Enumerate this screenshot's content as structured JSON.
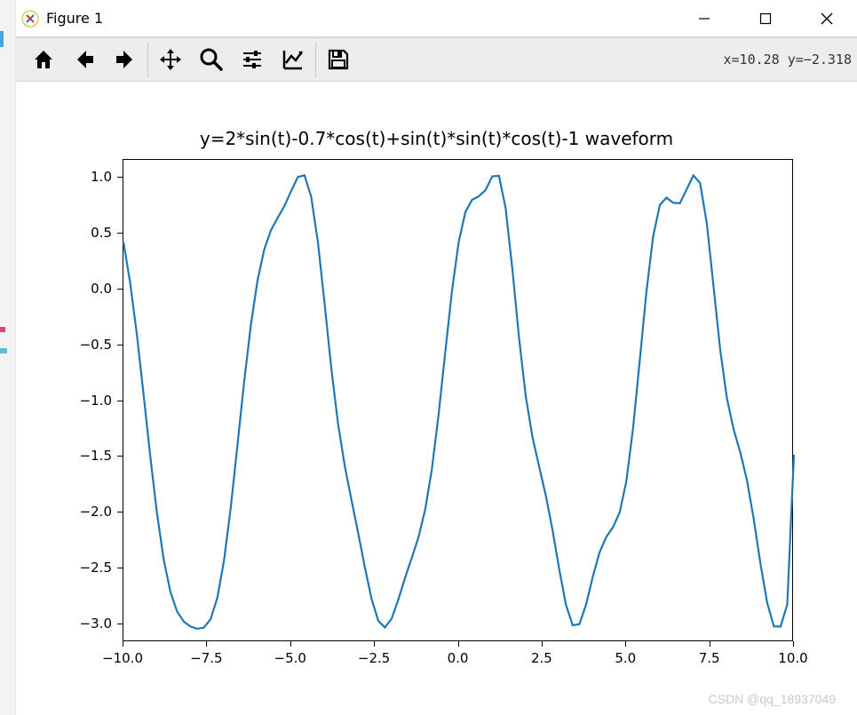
{
  "window": {
    "title": "Figure 1",
    "controls": {
      "min": "minimize",
      "max": "maximize",
      "close": "close"
    }
  },
  "toolbar": {
    "items": [
      "home",
      "back",
      "forward",
      "sep",
      "pan",
      "zoom",
      "configure",
      "edit-axes",
      "sep",
      "save"
    ],
    "readout": "x=10.28 y=−2.318"
  },
  "watermark": "CSDN @qq_18937049",
  "chart_data": {
    "type": "line",
    "title": "y=2*sin(t)-0.7*cos(t)+sin(t)*sin(t)*cos(t)-1 waveform",
    "xlabel": "",
    "ylabel": "",
    "xlim": [
      -10,
      10
    ],
    "ylim": [
      -3.16,
      1.16
    ],
    "xticks": [
      -10.0,
      -7.5,
      -5.0,
      -2.5,
      0.0,
      2.5,
      5.0,
      7.5,
      10.0
    ],
    "yticks": [
      -3.0,
      -2.5,
      -2.0,
      -1.5,
      -1.0,
      -0.5,
      0.0,
      0.5,
      1.0
    ],
    "line_color": "#1f77b4",
    "x": [
      -10.0,
      -9.8,
      -9.6,
      -9.4,
      -9.2,
      -9.0,
      -8.8,
      -8.6,
      -8.4,
      -8.2,
      -8.0,
      -7.8,
      -7.6,
      -7.4,
      -7.2,
      -7.0,
      -6.8,
      -6.6,
      -6.4,
      -6.2,
      -6.0,
      -5.8,
      -5.6,
      -5.4,
      -5.2,
      -5.0,
      -4.8,
      -4.6,
      -4.4,
      -4.2,
      -4.0,
      -3.8,
      -3.6,
      -3.4,
      -3.2,
      -3.0,
      -2.8,
      -2.6,
      -2.4,
      -2.2,
      -2.0,
      -1.8,
      -1.6,
      -1.4,
      -1.2,
      -1.0,
      -0.8,
      -0.6,
      -0.4,
      -0.2,
      0.0,
      0.2,
      0.4,
      0.6,
      0.8,
      1.0,
      1.2,
      1.4,
      1.6,
      1.8,
      2.0,
      2.2,
      2.4,
      2.6,
      2.8,
      3.0,
      3.2,
      3.4,
      3.6,
      3.8,
      4.0,
      4.2,
      4.4,
      4.6,
      4.8,
      5.0,
      5.2,
      5.4,
      5.6,
      5.8,
      6.0,
      6.2,
      6.4,
      6.6,
      6.8,
      7.0,
      7.2,
      7.4,
      7.6,
      7.8,
      8.0,
      8.2,
      8.4,
      8.6,
      8.8,
      9.0,
      9.2,
      9.4,
      9.6,
      9.8,
      10.0
    ],
    "y": [
      0.425,
      0.061,
      -0.403,
      -0.939,
      -1.494,
      -2.004,
      -2.418,
      -2.709,
      -2.885,
      -2.976,
      -3.02,
      -3.04,
      -3.03,
      -2.954,
      -2.763,
      -2.428,
      -1.957,
      -1.399,
      -0.829,
      -0.321,
      0.08,
      0.358,
      0.53,
      0.641,
      0.746,
      0.879,
      1.006,
      1.022,
      0.83,
      0.425,
      -0.127,
      -0.706,
      -1.2,
      -1.578,
      -1.884,
      -2.18,
      -2.487,
      -2.771,
      -2.968,
      -3.028,
      -2.949,
      -2.778,
      -2.584,
      -2.405,
      -2.221,
      -1.974,
      -1.611,
      -1.122,
      -0.56,
      -0.013,
      0.425,
      0.693,
      0.802,
      0.834,
      0.889,
      1.012,
      1.018,
      0.728,
      0.185,
      -0.434,
      -0.956,
      -1.322,
      -1.588,
      -1.848,
      -2.158,
      -2.508,
      -2.827,
      -3.009,
      -2.999,
      -2.823,
      -2.574,
      -2.357,
      -2.219,
      -2.131,
      -2.0,
      -1.72,
      -1.247,
      -0.639,
      -0.02,
      0.475,
      0.756,
      0.822,
      0.775,
      0.772,
      0.895,
      1.021,
      0.953,
      0.593,
      0.031,
      -0.539,
      -0.975,
      -1.253,
      -1.46,
      -1.712,
      -2.057,
      -2.454,
      -2.805,
      -3.018,
      -3.021,
      -2.822,
      -1.481
    ]
  }
}
